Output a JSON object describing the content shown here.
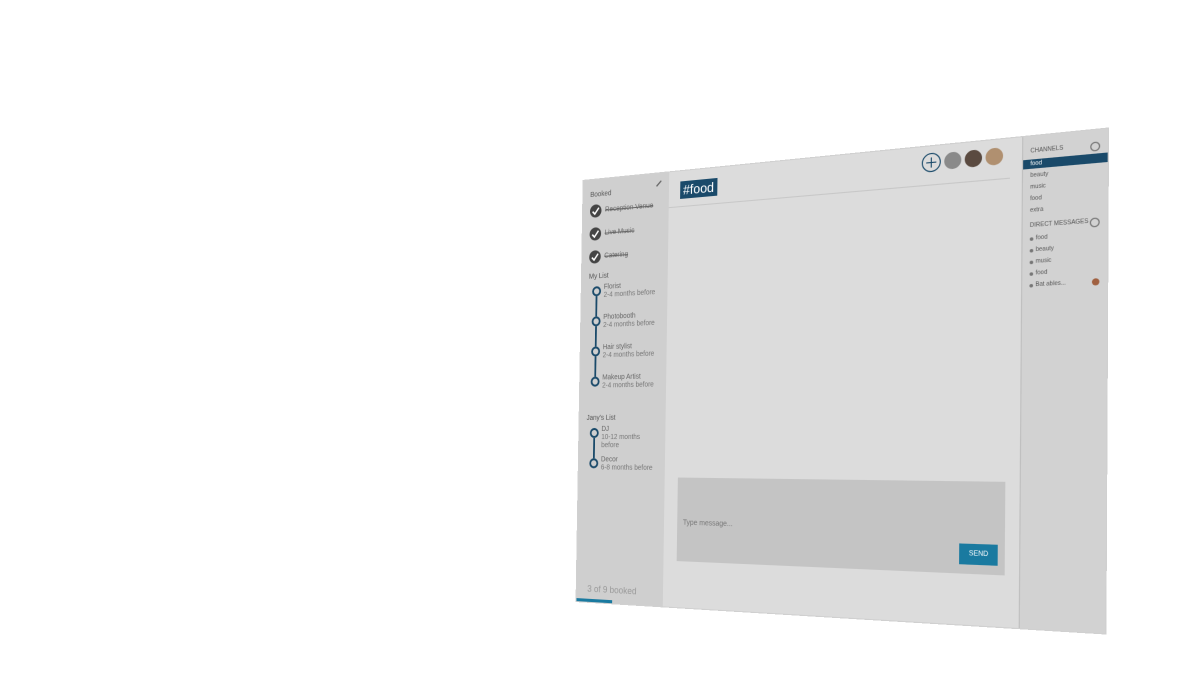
{
  "left": {
    "booked_title": "Booked",
    "booked": [
      "Reception Venue",
      "Live Music",
      "Catering"
    ],
    "my_list_title": "My List",
    "my_list": [
      {
        "name": "Florist",
        "when": "2-4 months before"
      },
      {
        "name": "Photobooth",
        "when": "2-4 months before"
      },
      {
        "name": "Hair stylist",
        "when": "2-4 months before"
      },
      {
        "name": "Makeup Artist",
        "when": "2-4 months before"
      }
    ],
    "janys_list_title": "Jany's List",
    "janys_list": [
      {
        "name": "DJ",
        "when": "10-12 months before"
      },
      {
        "name": "Decor",
        "when": "6-8 months before"
      }
    ],
    "footer": "3 of 9 booked"
  },
  "center": {
    "title": "#food",
    "compose_placeholder": "Type message...",
    "send_label": "SEND"
  },
  "right": {
    "channels_title": "CHANNELS",
    "channels": [
      "food",
      "beauty",
      "music",
      "food",
      "extra"
    ],
    "dm_title": "DIRECT MESSAGES",
    "dms": [
      "food",
      "beauty",
      "music",
      "food",
      "Bat ables..."
    ]
  },
  "colors": {
    "accent": "#1a4a6a",
    "send": "#1a7aa0"
  }
}
